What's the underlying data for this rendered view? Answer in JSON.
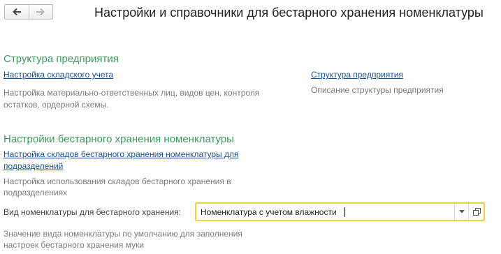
{
  "header": {
    "title": "Настройки и справочники для бестарного хранения номенклатуры",
    "back_icon": "arrow-left-icon",
    "forward_icon": "arrow-right-icon"
  },
  "sections": {
    "structure": {
      "title": "Структура предприятия",
      "left_link": "Настройка складского учета",
      "left_desc_line1": "Настройка материально-ответственных лиц, видов цен, контроля",
      "left_desc_line2": "остатков, ордерной схемы.",
      "right_link": "Структура предприятия",
      "right_desc": "Описание структуры предприятия"
    },
    "bulk": {
      "title": "Настройки бестарного хранения номенклатуры",
      "link_line1": "Настройка складов бестарного хранения номенклатуры для",
      "link_line2": "подразделений",
      "desc_line1": "Настройка использования складов бестарного хранения в",
      "desc_line2": "подразделениях",
      "field_label": "Вид номенклатуры для бестарного хранения:",
      "field_value": "Номенклатура с учетом влажности",
      "field_desc_line1": "Значение вида номенклатуры по умолчанию для заполнения",
      "field_desc_line2": "настроек бестарного хранения муки"
    }
  },
  "colors": {
    "section_title": "#3a9b5e",
    "link": "#1c4f8f",
    "description": "#7a7a7a",
    "focus_border": "#f2d046"
  }
}
